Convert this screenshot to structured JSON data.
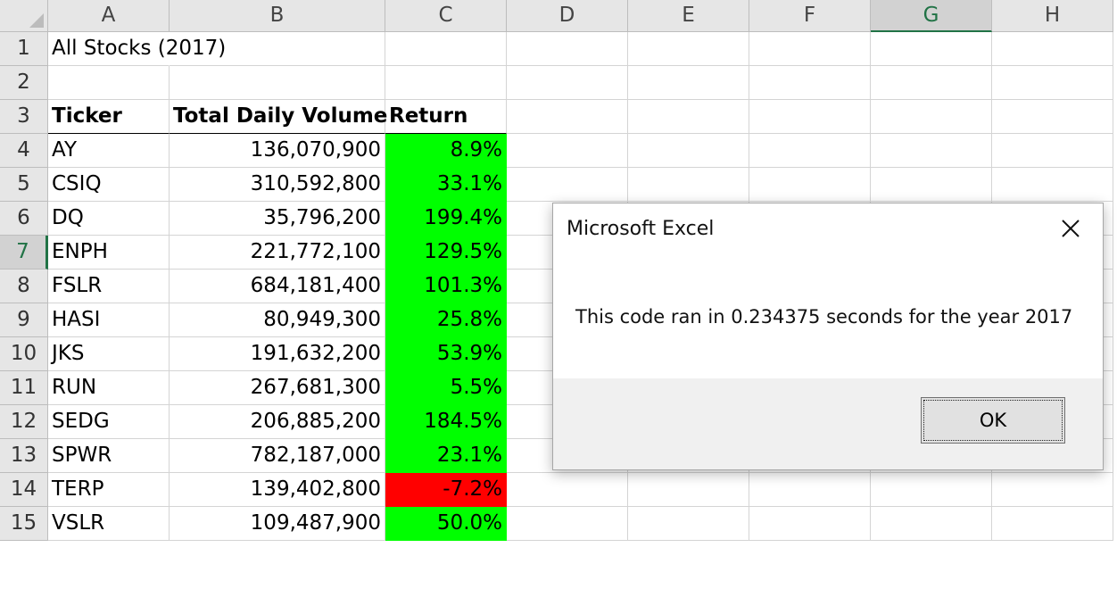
{
  "columns": [
    "A",
    "B",
    "C",
    "D",
    "E",
    "F",
    "G",
    "H"
  ],
  "active_column": "G",
  "active_row": 7,
  "rows": [
    1,
    2,
    3,
    4,
    5,
    6,
    7,
    8,
    9,
    10,
    11,
    12,
    13,
    14,
    15
  ],
  "sheet": {
    "title": "All Stocks (2017)",
    "headers": {
      "ticker": "Ticker",
      "volume": "Total Daily Volume",
      "return": "Return"
    },
    "records": [
      {
        "ticker": "AY",
        "volume": "136,070,900",
        "return": "8.9%",
        "status": "positive"
      },
      {
        "ticker": "CSIQ",
        "volume": "310,592,800",
        "return": "33.1%",
        "status": "positive"
      },
      {
        "ticker": "DQ",
        "volume": "35,796,200",
        "return": "199.4%",
        "status": "positive"
      },
      {
        "ticker": "ENPH",
        "volume": "221,772,100",
        "return": "129.5%",
        "status": "positive"
      },
      {
        "ticker": "FSLR",
        "volume": "684,181,400",
        "return": "101.3%",
        "status": "positive"
      },
      {
        "ticker": "HASI",
        "volume": "80,949,300",
        "return": "25.8%",
        "status": "positive"
      },
      {
        "ticker": "JKS",
        "volume": "191,632,200",
        "return": "53.9%",
        "status": "positive"
      },
      {
        "ticker": "RUN",
        "volume": "267,681,300",
        "return": "5.5%",
        "status": "positive"
      },
      {
        "ticker": "SEDG",
        "volume": "206,885,200",
        "return": "184.5%",
        "status": "positive"
      },
      {
        "ticker": "SPWR",
        "volume": "782,187,000",
        "return": "23.1%",
        "status": "positive"
      },
      {
        "ticker": "TERP",
        "volume": "139,402,800",
        "return": "-7.2%",
        "status": "negative"
      },
      {
        "ticker": "VSLR",
        "volume": "109,487,900",
        "return": "50.0%",
        "status": "positive"
      }
    ]
  },
  "colors": {
    "positive_fill": "#00ff00",
    "negative_fill": "#ff0000",
    "accent": "#217346"
  },
  "dialog": {
    "title": "Microsoft Excel",
    "message": "This code ran in 0.234375 seconds for the year 2017",
    "ok_label": "OK",
    "close_icon": "close-icon"
  }
}
